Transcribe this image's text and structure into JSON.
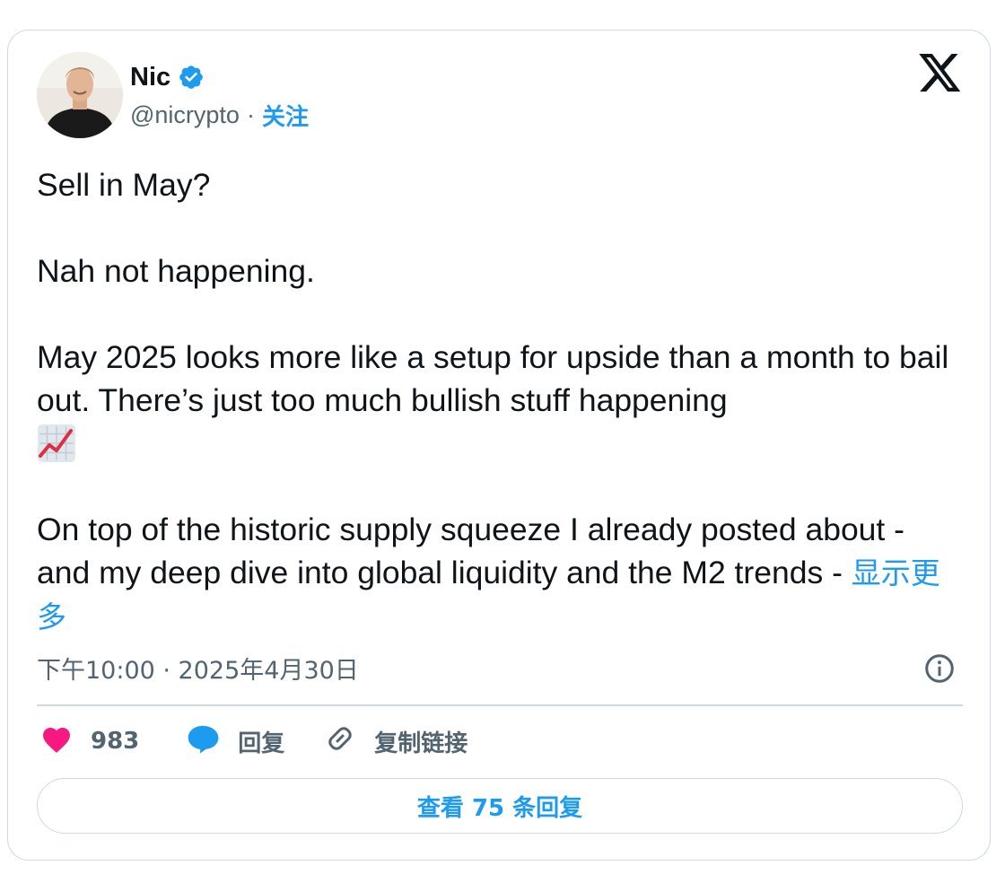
{
  "author": {
    "name": "Nic",
    "handle": "@nicrypto",
    "separator": "·",
    "follow_label": "关注",
    "verified_color": "#1d9bf0"
  },
  "tweet": {
    "paragraphs": [
      "Sell in May?",
      "Nah not happening.",
      "May 2025 looks more like a setup for upside than a month to bail out. There’s just too much bullish stuff happening",
      "On top of the historic supply squeeze I already posted about - and my deep dive into global liquidity and the M2 trends -"
    ],
    "emoji": "chart-increasing-emoji",
    "show_more_label": "显示更多"
  },
  "meta": {
    "timestamp": "下午10:00 · 2025年4月30日"
  },
  "actions": {
    "like_count": "983",
    "reply_label": "回复",
    "copy_link_label": "复制链接"
  },
  "replies_button_label": "查看 75 条回复",
  "colors": {
    "accent": "#1d9bf0",
    "like": "#f91880",
    "text": "#0f1419",
    "secondary": "#536471",
    "border": "#cfd9de"
  }
}
